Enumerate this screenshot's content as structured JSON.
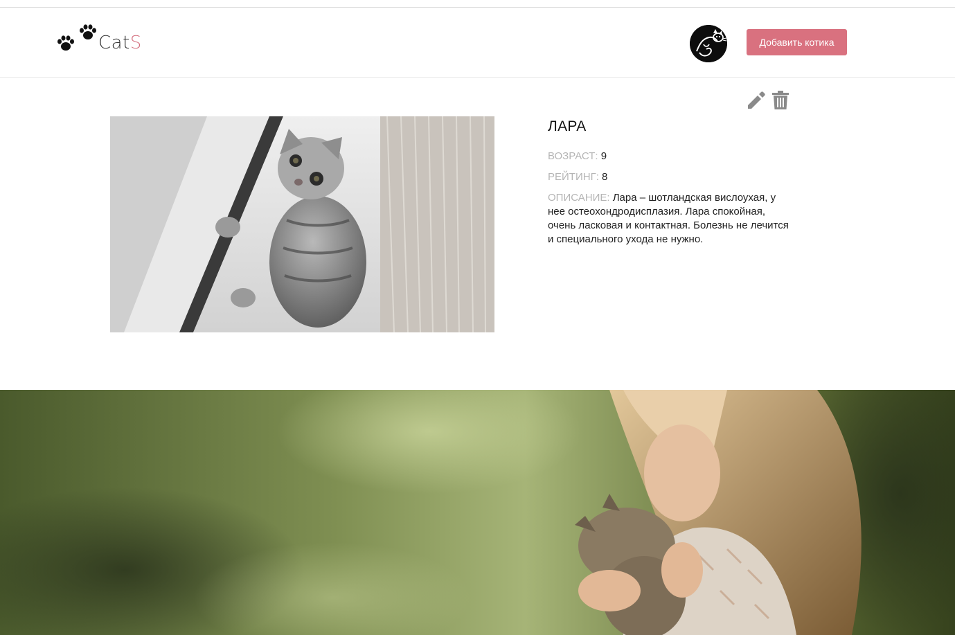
{
  "header": {
    "logo_text": "Cat",
    "logo_accent": "S",
    "add_button_label": "Добавить котика"
  },
  "icons": {
    "logo": "paw-icon",
    "avatar": "cat-avatar",
    "edit": "pencil-icon",
    "delete": "trash-icon"
  },
  "cat": {
    "name": "ЛАРА",
    "age_label": "ВОЗРАСТ:",
    "age": "9",
    "rating_label": "РЕЙТИНГ:",
    "rating": "8",
    "description_label": "ОПИСАНИЕ:",
    "description": "Лара – шотландская вислоухая, у нее остеохондродисплазия. Лара спокойная, очень ласковая и контактная. Болезнь не лечится и специального ухода не нужно."
  },
  "colors": {
    "accent": "#d9717f",
    "label_gray": "#b5b5b5",
    "icon_gray": "#8a8a8a"
  }
}
